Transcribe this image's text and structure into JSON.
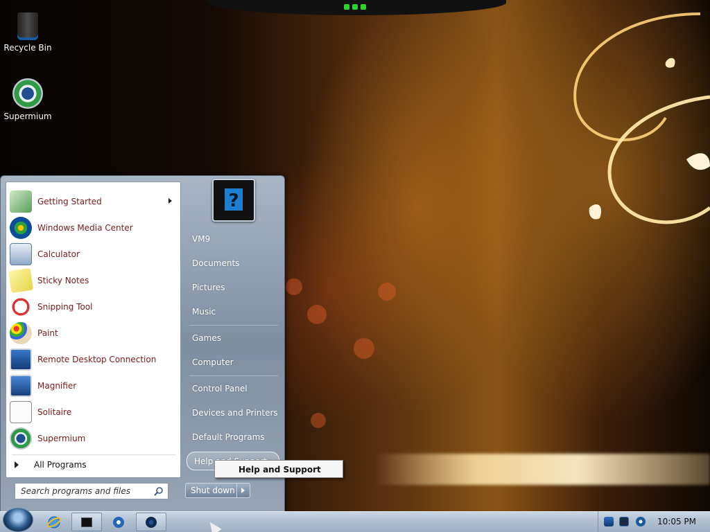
{
  "desktop": {
    "icons": [
      {
        "label": "Recycle Bin",
        "icon": "recycle-bin-icon"
      },
      {
        "label": "Supermium",
        "icon": "supermium-browser-icon"
      }
    ]
  },
  "start_menu": {
    "programs": [
      {
        "label": "Getting Started",
        "icon": "getting-started-icon",
        "has_submenu": true
      },
      {
        "label": "Windows Media Center",
        "icon": "windows-media-center-icon"
      },
      {
        "label": "Calculator",
        "icon": "calculator-icon"
      },
      {
        "label": "Sticky Notes",
        "icon": "sticky-notes-icon"
      },
      {
        "label": "Snipping Tool",
        "icon": "snipping-tool-icon"
      },
      {
        "label": "Paint",
        "icon": "paint-icon"
      },
      {
        "label": "Remote Desktop Connection",
        "icon": "remote-desktop-icon"
      },
      {
        "label": "Magnifier",
        "icon": "magnifier-icon"
      },
      {
        "label": "Solitaire",
        "icon": "solitaire-icon"
      },
      {
        "label": "Supermium",
        "icon": "supermium-browser-icon"
      }
    ],
    "all_programs_label": "All Programs",
    "search_placeholder": "Search programs and files",
    "right_links": [
      {
        "label": "VM9"
      },
      {
        "label": "Documents"
      },
      {
        "label": "Pictures"
      },
      {
        "label": "Music"
      },
      {
        "label": "Games"
      },
      {
        "label": "Computer"
      },
      {
        "label": "Control Panel"
      },
      {
        "label": "Devices and Printers"
      },
      {
        "label": "Default Programs"
      },
      {
        "label": "Help and Support"
      }
    ],
    "shutdown_label": "Shut down",
    "tooltip": "Help and Support"
  },
  "taskbar": {
    "pinned": [
      "internet-explorer-icon",
      "command-prompt-icon",
      "media-player-icon",
      "supermium-browser-icon"
    ],
    "tray_icons": [
      "shield-icon",
      "network-icon",
      "volume-icon"
    ],
    "clock": "10:05 PM"
  }
}
